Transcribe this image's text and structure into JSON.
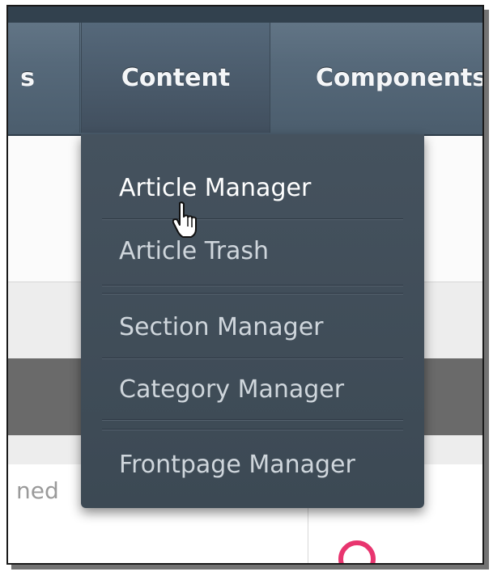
{
  "nav": {
    "items": [
      {
        "label": "s"
      },
      {
        "label": "Content"
      },
      {
        "label": "Components"
      }
    ]
  },
  "dropdown": {
    "items": [
      {
        "label": "Article Manager"
      },
      {
        "label": "Article Trash"
      },
      {
        "label": "Section Manager"
      },
      {
        "label": "Category Manager"
      },
      {
        "label": "Frontpage Manager"
      }
    ]
  },
  "background": {
    "partial_text": "ned"
  },
  "colors": {
    "nav_bar": "#56697a",
    "dropdown_bg": "#404d58",
    "accent_ring": "#e8356f"
  }
}
